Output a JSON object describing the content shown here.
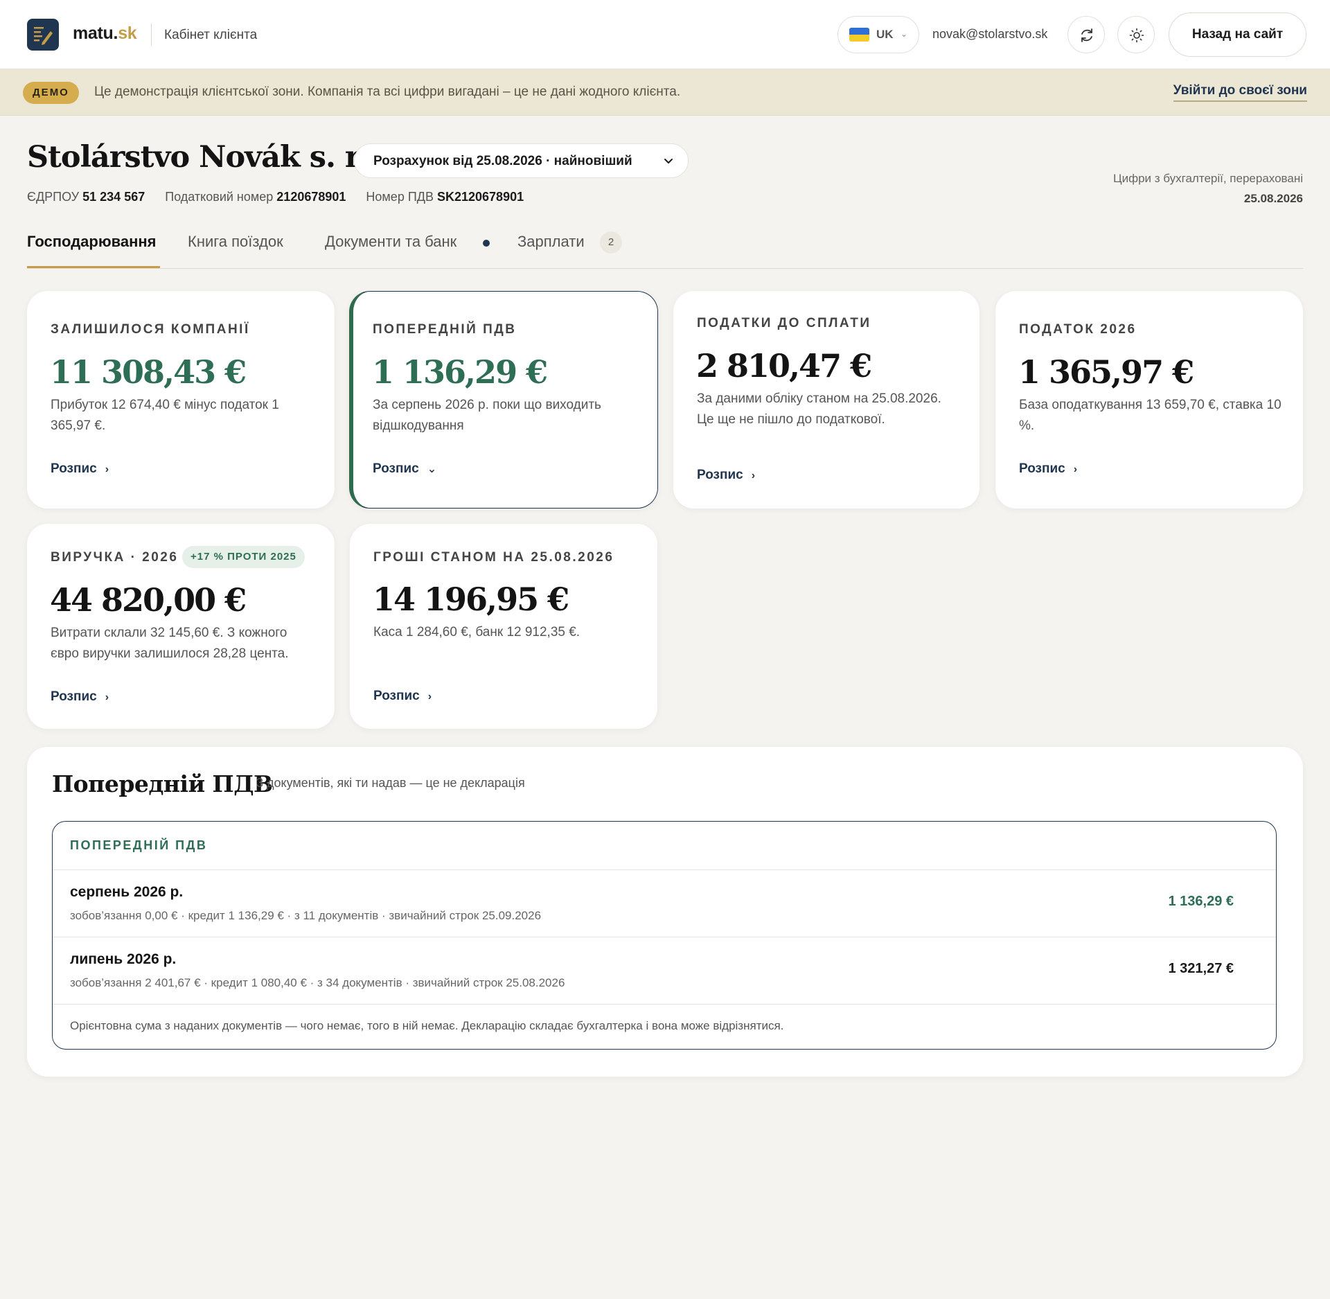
{
  "header": {
    "brand_main": "matu.",
    "brand_tld": "sk",
    "brand_subtitle": "Кабінет клієнта",
    "language_code": "UK",
    "language_flag": "ukraine-flag",
    "user_email": "novak@stolarstvo.sk",
    "back_button": "Назад на сайт"
  },
  "demo_banner": {
    "badge": "ДЕМО",
    "text": "Це демонстрація клієнтської зони. Компанія та всі цифри вигадані – це не дані жодного клієнта.",
    "link": "Увійти до своєї зони"
  },
  "company": {
    "name": "Stolárstvo Novák s. r. o.",
    "calculation_select": "Розрахунок від 25.08.2026 · найновіший",
    "edrpou_label": "ЄДРПОУ",
    "edrpou_value": "51 234 567",
    "tax_no_label": "Податковий номер",
    "tax_no_value": "2120678901",
    "vat_no_label": "Номер ПДВ",
    "vat_no_value": "SK2120678901",
    "note_line1": "Цифри з бухгалтерії, перераховані",
    "note_date": "25.08.2026"
  },
  "tabs": [
    {
      "label": "Господарювання"
    },
    {
      "label": "Книга поїздок"
    },
    {
      "label": "Документи та банк"
    },
    {
      "label": "Зарплати",
      "count": "2"
    }
  ],
  "cards": [
    {
      "label": "ЗАЛИШИЛОСЯ КОМПАНІЇ",
      "value": "11 308,43 €",
      "desc": "Прибуток 12 674,40 € мінус податок 1 365,97 €.",
      "more": "Розпис"
    },
    {
      "label": "ПОПЕРЕДНІЙ ПДВ",
      "value": "1 136,29 €",
      "desc": "За серпень 2026 р. поки що виходить відшкодування",
      "more": "Розпис"
    },
    {
      "label": "ПОДАТКИ ДО СПЛАТИ",
      "value": "2 810,47 €",
      "desc": "За даними обліку станом на 25.08.2026. Це ще не пішло до податкової.",
      "more": "Розпис"
    },
    {
      "label": "ПОДАТОК 2026",
      "value": "1 365,97 €",
      "desc": "База оподаткування 13 659,70 €, ставка 10 %.",
      "more": "Розпис"
    },
    {
      "label": "ВИРУЧКА · 2026",
      "badge": "+17 % ПРОТИ 2025",
      "value": "44 820,00 €",
      "desc": "Витрати склали 32 145,60 €. З кожного євро виручки залишилося 28,28 цента.",
      "more": "Розпис"
    },
    {
      "label": "ГРОШІ СТАНОМ НА 25.08.2026",
      "value": "14 196,95 €",
      "desc": "Каса 1 284,60 €, банк 12 912,35 €.",
      "more": "Розпис"
    }
  ],
  "vat": {
    "title": "Попередній ПДВ",
    "subtitle": "3 документів, які ти надав — це не декларація",
    "box_header": "ПОПЕРЕДНІЙ ПДВ",
    "rows": [
      {
        "month": "серпень 2026 р.",
        "detail": "зобов’язання 0,00 € · кредит 1 136,29 € · з 11 документів · звичайний строк 25.09.2026",
        "amount": "1 136,29 €"
      },
      {
        "month": "липень 2026 р.",
        "detail": "зобов’язання 2 401,67 € · кредит 1 080,40 € · з 34 документів · звичайний строк 25.08.2026",
        "amount": "1 321,27 €"
      }
    ],
    "note": "Орієнтовна сума з наданих документів — чого немає, того в ній немає. Декларацію складає бухгалтерка і вона може відрізнятися."
  },
  "colors": {
    "navy": "#1f3550",
    "gold": "#c59d4a",
    "green": "#2e6e54",
    "page_bg": "#f4f3ef",
    "demo_bg": "#ece6d4"
  }
}
